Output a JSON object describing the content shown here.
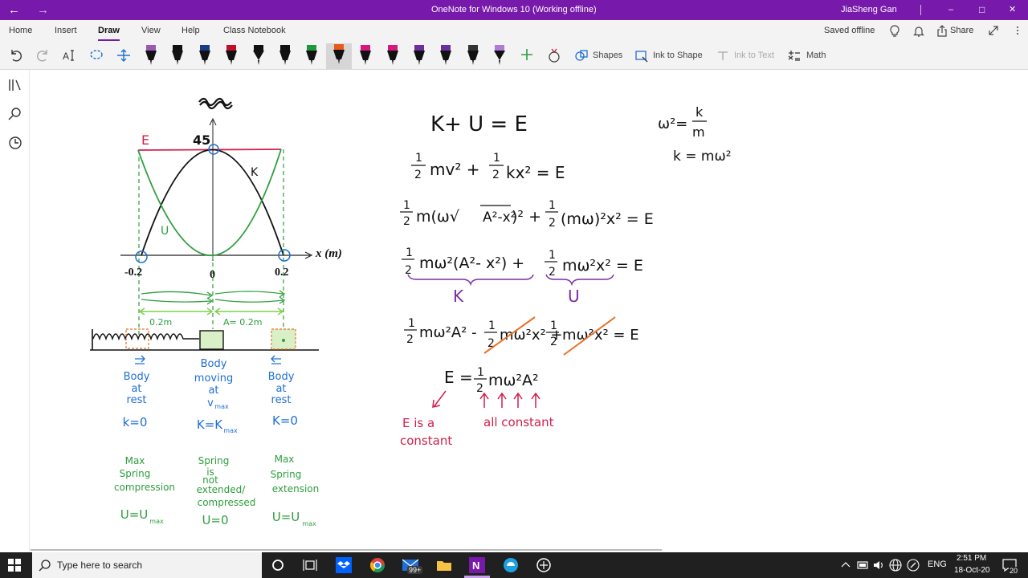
{
  "titlebar": {
    "title": "OneNote for Windows 10 (Working offline)",
    "user": "JiaSheng Gan",
    "back_glyph": "←",
    "forward_glyph": "→",
    "min_glyph": "–",
    "max_glyph": "□",
    "close_glyph": "✕",
    "bg_color": "#7719aa"
  },
  "ribbon": {
    "tabs": [
      "Home",
      "Insert",
      "Draw",
      "View",
      "Help",
      "Class Notebook"
    ],
    "active_tab": "Draw",
    "status": "Saved offline",
    "share_label": "Share"
  },
  "toolbar": {
    "shapes_label": "Shapes",
    "ink_to_shape_label": "Ink to Shape",
    "ink_to_text_label": "Ink to Text",
    "math_label": "Math",
    "pen_colors": [
      "#9b59b6",
      "#111111",
      "#1a3a8a",
      "#c0102a",
      "#111111",
      "#111111",
      "#1f9a3a",
      "#e85a1a",
      "#d6197a",
      "#d6197a",
      "#6d2fa0",
      "#6d2fa0",
      "#333333",
      "#b07ad6"
    ]
  },
  "graph": {
    "peak_value": "45",
    "energy_label": "E",
    "kinetic_label": "K",
    "potential_label": "U",
    "x_axis_label": "x (m)",
    "tick_left": "-0.2",
    "tick_mid": "0",
    "tick_right": "0.2",
    "dim_left": "0.2m",
    "dim_right": "A= 0.2m"
  },
  "positions": [
    {
      "state": [
        "Body",
        "at",
        "rest"
      ],
      "k": "k=0",
      "spring": [
        "Max",
        "Spring",
        "compression"
      ],
      "u": "U=U",
      "u_sub": "max"
    },
    {
      "state": [
        "Body",
        "moving",
        "at",
        "v"
      ],
      "state_sub": "max",
      "k": "K=K",
      "k_sub": "max",
      "spring": [
        "Spring",
        "is",
        "not",
        "extended/",
        "compressed"
      ],
      "u": "U=0"
    },
    {
      "state": [
        "Body",
        "at",
        "rest"
      ],
      "k": "K=0",
      "spring": [
        "Max",
        "Spring",
        "extension"
      ],
      "u": "U=U",
      "u_sub": "max"
    }
  ],
  "equations": {
    "line1": "K+ U = E",
    "omega_sq": "ω²=",
    "omega_frac_num": "k",
    "omega_frac_den": "m",
    "k_eq": "k = mω²",
    "line2_a": "mv² +",
    "line2_b": "kx² = E",
    "line3_a": "m(ω√",
    "line3_root": "A²-x²",
    "line3_b": ")² +",
    "line3_c": "(mω)²x² = E",
    "line4_a": "mω²(A²- x²) +",
    "line4_b": "mω²x² = E",
    "brace_k": "K",
    "brace_u": "U",
    "line5_a": "mω²A² -",
    "line5_b": "mω²x² +",
    "line5_c": "mω²x² = E",
    "line6_a": "E =",
    "line6_b": "mω²A²",
    "half_num": "1",
    "half_den": "2",
    "note_left": [
      "E is a",
      "constant"
    ],
    "note_right": "all constant"
  },
  "colors": {
    "energy_red": "#d21f4b",
    "green": "#2e9e3e",
    "light_green": "#7cd34a",
    "purple": "#7a2ca3",
    "orange": "#e8712a",
    "blue": "#1e6fd6"
  },
  "taskbar": {
    "search_placeholder": "Type here to search",
    "badge": "99+",
    "lang": "ENG",
    "time": "2:51 PM",
    "date": "18-Oct-20",
    "notif_count": "20"
  }
}
